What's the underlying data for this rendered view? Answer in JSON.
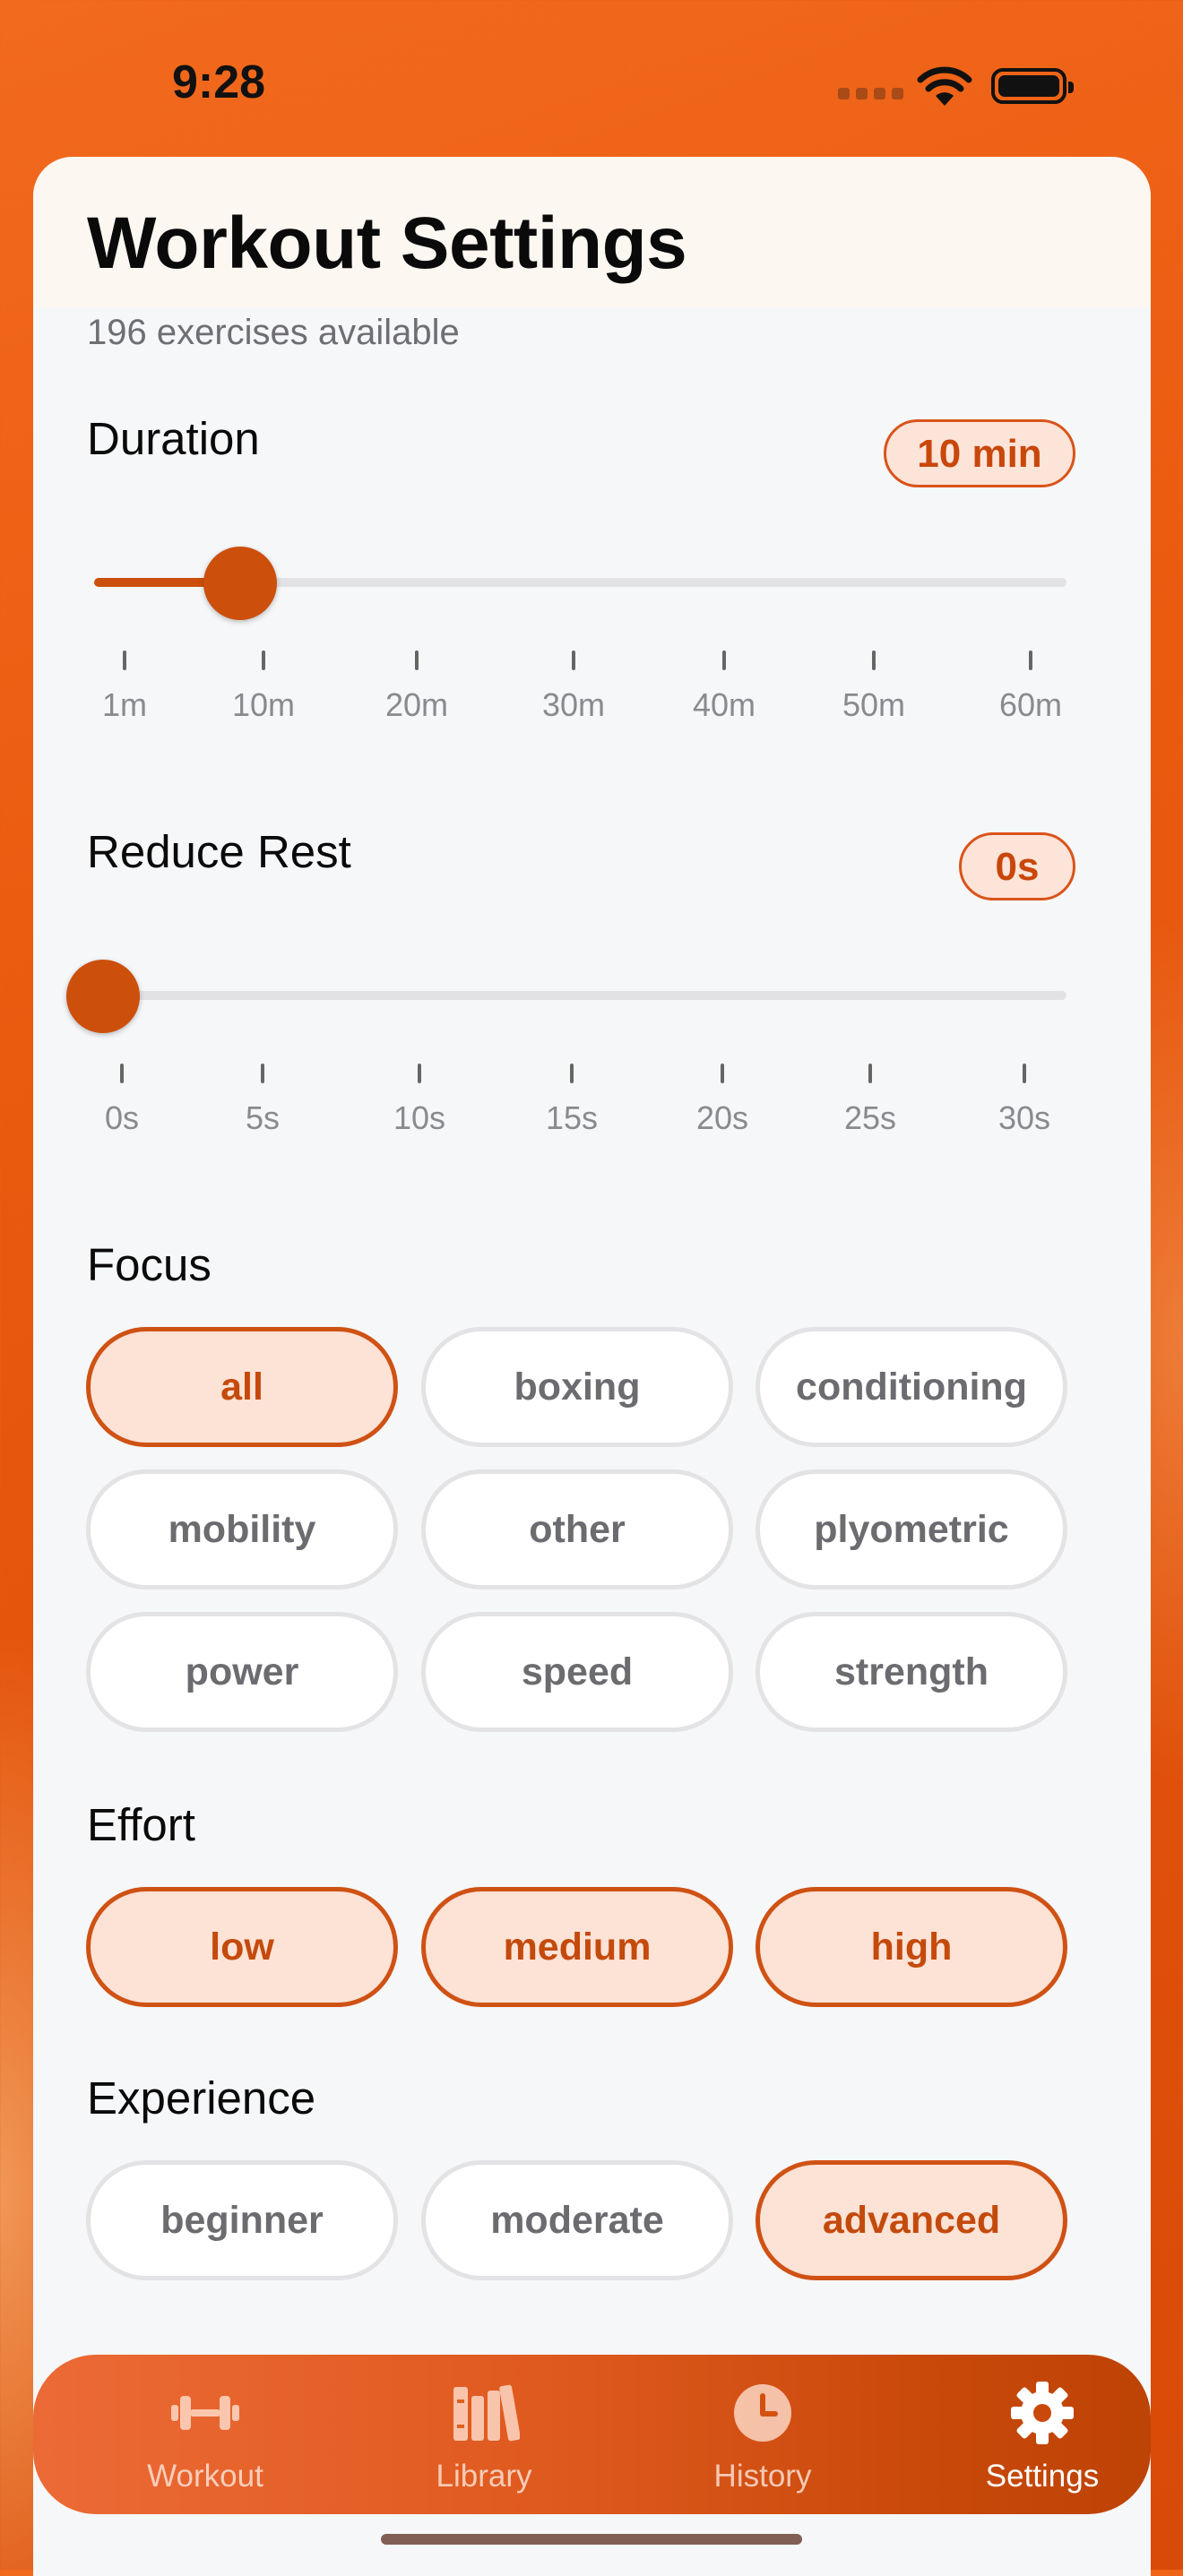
{
  "status_bar": {
    "time": "9:28"
  },
  "header": {
    "title": "Workout Settings",
    "subtitle": "196 exercises available"
  },
  "duration": {
    "label": "Duration",
    "value": "10 min",
    "slider_fraction": 0.15,
    "ticks": [
      "1m",
      "10m",
      "20m",
      "30m",
      "40m",
      "50m",
      "60m"
    ]
  },
  "reduce_rest": {
    "label": "Reduce Rest",
    "value": "0s",
    "slider_fraction": 0.0,
    "ticks": [
      "0s",
      "5s",
      "10s",
      "15s",
      "20s",
      "25s",
      "30s"
    ]
  },
  "focus": {
    "label": "Focus",
    "options": [
      {
        "label": "all",
        "selected": true
      },
      {
        "label": "boxing",
        "selected": false
      },
      {
        "label": "conditioning",
        "selected": false
      },
      {
        "label": "mobility",
        "selected": false
      },
      {
        "label": "other",
        "selected": false
      },
      {
        "label": "plyometric",
        "selected": false
      },
      {
        "label": "power",
        "selected": false
      },
      {
        "label": "speed",
        "selected": false
      },
      {
        "label": "strength",
        "selected": false
      }
    ]
  },
  "effort": {
    "label": "Effort",
    "options": [
      {
        "label": "low",
        "selected": true
      },
      {
        "label": "medium",
        "selected": true
      },
      {
        "label": "high",
        "selected": true
      }
    ]
  },
  "experience": {
    "label": "Experience",
    "options": [
      {
        "label": "beginner",
        "selected": false
      },
      {
        "label": "moderate",
        "selected": false
      },
      {
        "label": "advanced",
        "selected": true
      }
    ]
  },
  "tab_bar": {
    "tabs": [
      {
        "label": "Workout",
        "icon": "dumbbell-icon",
        "active": false
      },
      {
        "label": "Library",
        "icon": "books-icon",
        "active": false
      },
      {
        "label": "History",
        "icon": "clock-icon",
        "active": false
      },
      {
        "label": "Settings",
        "icon": "gear-icon",
        "active": true
      }
    ]
  },
  "colors": {
    "accent": "#cc4f0c",
    "selected_bg": "#fde2d6",
    "background": "#e85a12"
  }
}
